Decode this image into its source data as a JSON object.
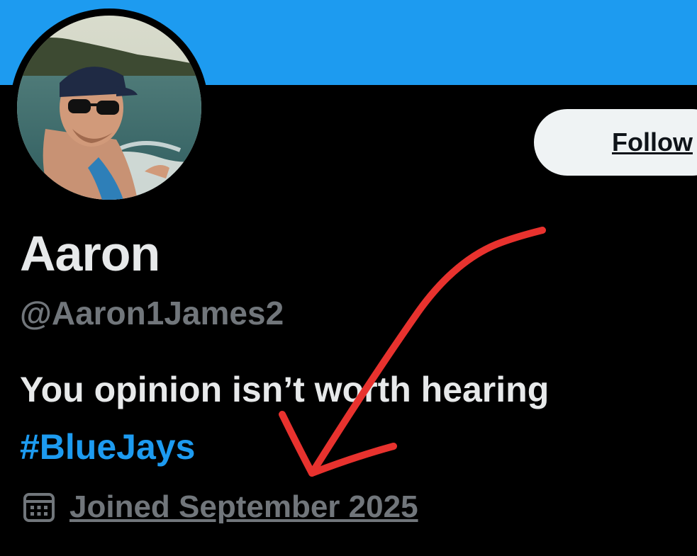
{
  "profile": {
    "display_name": "Aaron",
    "handle": "@Aaron1James2",
    "bio": "You opinion isn’t worth hearing",
    "hashtag": "#BlueJays",
    "joined": "Joined September 2025",
    "follow_label": "Follow",
    "avatar_icon": "profile-photo",
    "calendar_icon": "calendar-icon"
  },
  "colors": {
    "banner": "#1d9bf0",
    "background": "#000000",
    "primary_text": "#e7e9ea",
    "secondary_text": "#71767b",
    "link": "#1d9bf0",
    "follow_button_bg": "#eff3f4",
    "annotation_arrow": "#e8322e"
  },
  "annotation": {
    "type": "hand-drawn-arrow",
    "color": "#e8322e",
    "points_to": "joined date"
  }
}
